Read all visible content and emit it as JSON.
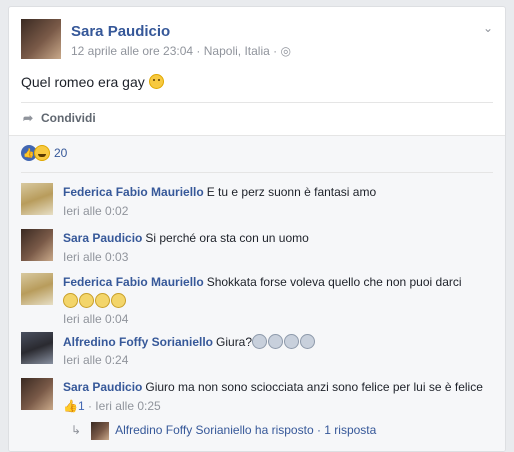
{
  "post": {
    "author": "Sara Paudicio",
    "meta": "12 aprile alle ore 23:04 · Napoli, Italia · ",
    "text": "Quel romeo era gay",
    "share_label": "Condividi",
    "reaction_count": "20"
  },
  "comments": [
    {
      "author": "Federica Fabio Mauriello",
      "text": "E tu e perz suonn è fantasi amo",
      "time": "Ieri alle 0:02"
    },
    {
      "author": "Sara Paudicio",
      "text": "Si perché ora sta con un uomo",
      "time": "Ieri alle 0:03"
    },
    {
      "author": "Federica Fabio Mauriello",
      "text": "Shokkata forse voleva quello che non puoi darci",
      "time": "Ieri alle 0:04"
    },
    {
      "author": "Alfredino Foffy Sorianiello",
      "text": "Giura?",
      "time": "Ieri alle 0:24"
    },
    {
      "author": "Sara Paudicio",
      "text": "Giuro ma non sono sciocciata anzi sono felice per lui se è felice",
      "likes": "1",
      "time": " · Ieri alle 0:25"
    }
  ],
  "reply": {
    "text": "Alfredino Foffy Sorianiello ha risposto · 1 risposta"
  }
}
